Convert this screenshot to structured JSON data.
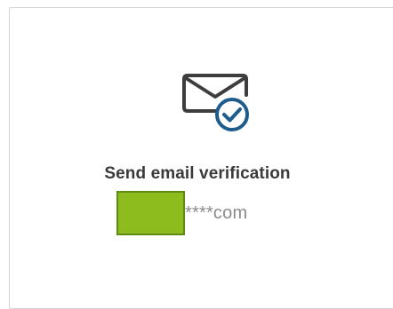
{
  "option": {
    "title": "Send email verification",
    "masked_email": "****com",
    "icon": "envelope-check-icon",
    "colors": {
      "envelope_stroke": "#3d3d3d",
      "check_badge": "#1d5c8c",
      "redaction_fill": "#8cbc1e"
    }
  }
}
